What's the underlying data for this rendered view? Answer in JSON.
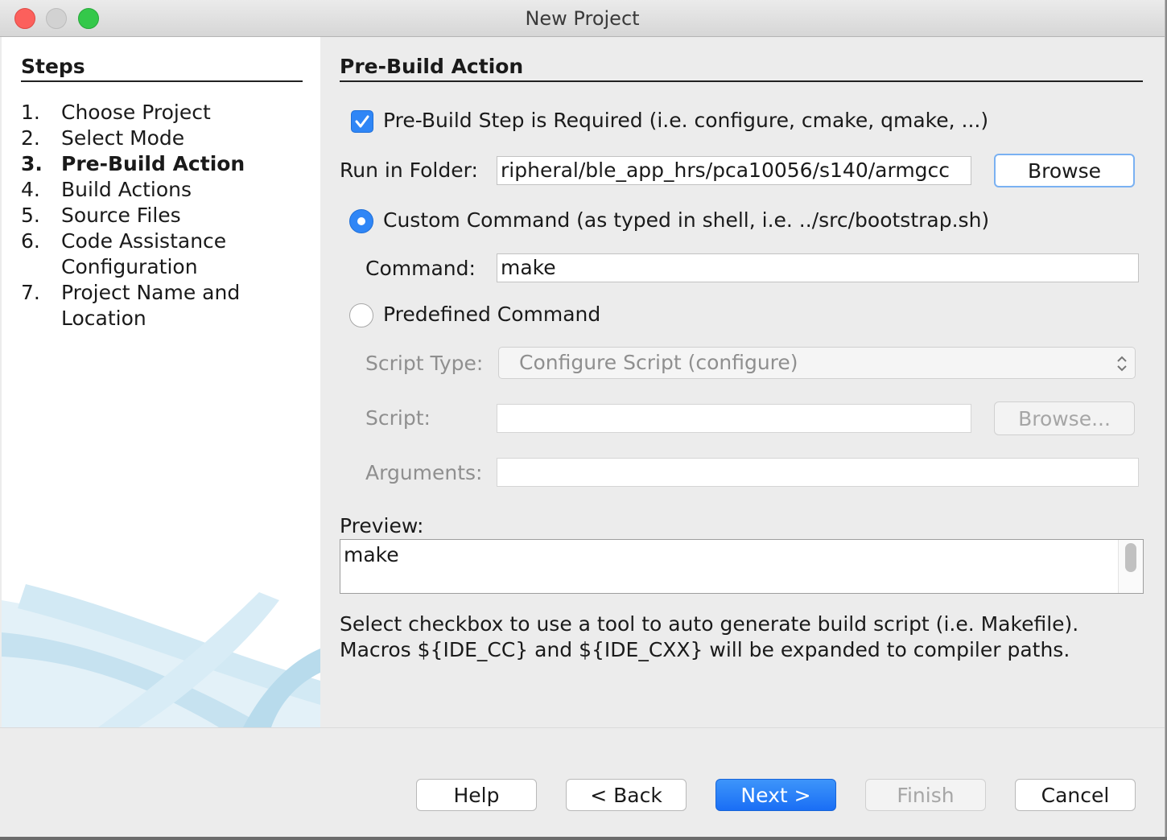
{
  "window": {
    "title": "New Project"
  },
  "steps": {
    "title": "Steps",
    "items": [
      {
        "num": "1.",
        "label": "Choose Project"
      },
      {
        "num": "2.",
        "label": "Select Mode"
      },
      {
        "num": "3.",
        "label": "Pre-Build Action",
        "current": true
      },
      {
        "num": "4.",
        "label": "Build Actions"
      },
      {
        "num": "5.",
        "label": "Source Files"
      },
      {
        "num": "6.",
        "label": "Code Assistance",
        "label2": "Configuration"
      },
      {
        "num": "7.",
        "label": "Project Name and",
        "label2": "Location"
      }
    ]
  },
  "main": {
    "section_title": "Pre-Build Action",
    "prebuild_checkbox": {
      "label": "Pre-Build Step is Required (i.e. configure, cmake, qmake, ...)",
      "checked": true
    },
    "run_in_folder": {
      "label": "Run in Folder:",
      "value": "ripheral/ble_app_hrs/pca10056/s140/armgcc",
      "browse_label": "Browse"
    },
    "custom_command": {
      "label": "Custom Command (as typed in shell, i.e. ../src/bootstrap.sh)",
      "selected": true,
      "command_label": "Command:",
      "command_value": "make"
    },
    "predefined_command": {
      "label": "Predefined Command",
      "selected": false,
      "script_type_label": "Script Type:",
      "script_type_value": "Configure Script (configure)",
      "script_label": "Script:",
      "script_value": "",
      "browse_label": "Browse...",
      "arguments_label": "Arguments:",
      "arguments_value": ""
    },
    "preview": {
      "label": "Preview:",
      "value": "make"
    },
    "help": {
      "line1": "Select checkbox to use a tool to auto generate build script (i.e. Makefile).",
      "line2": "Macros ${IDE_CC} and ${IDE_CXX} will be expanded to compiler paths."
    }
  },
  "footer": {
    "help": "Help",
    "back": "< Back",
    "next": "Next >",
    "finish": "Finish",
    "cancel": "Cancel"
  },
  "colors": {
    "accent": "#2f86f6",
    "primary_button": "#1a6ef5"
  }
}
